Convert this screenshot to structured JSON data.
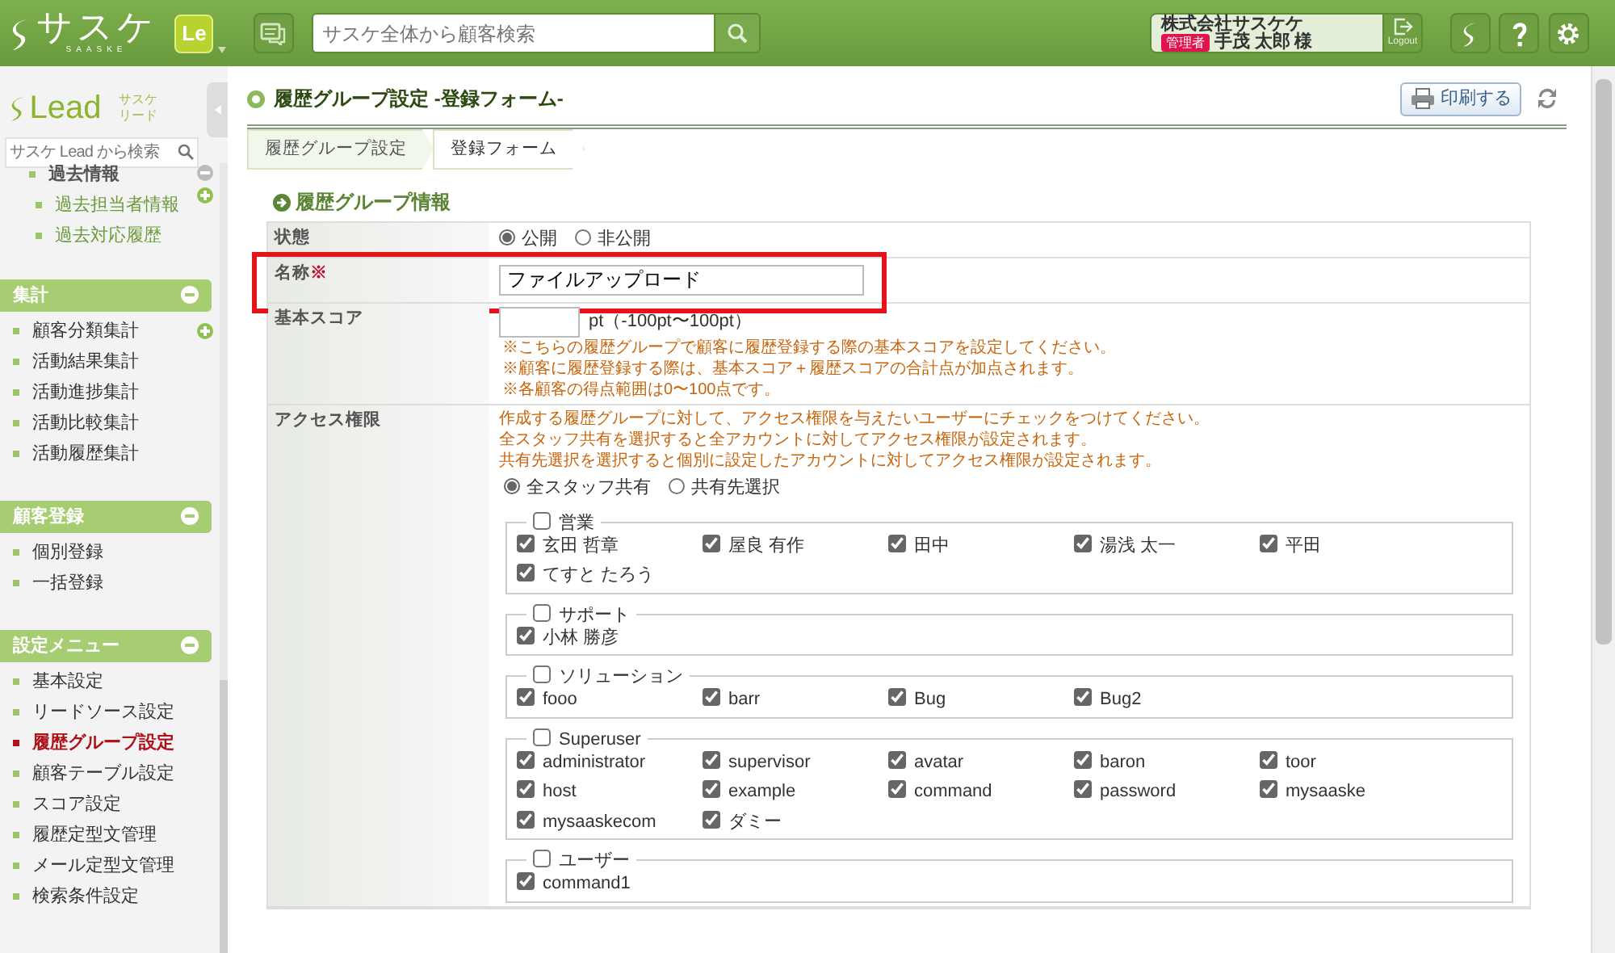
{
  "header": {
    "logo": "サスケ",
    "logo_sub": "SAASKE",
    "app_badge": "Le",
    "search": {
      "placeholder": "サスケ全体から顧客検索"
    },
    "user": {
      "company": "株式会社サスケケ",
      "role": "管理者",
      "name": "手茂 太郎",
      "honorific": "様",
      "logout": "Logout"
    }
  },
  "sidebar": {
    "brand": "Lead",
    "brand_sub_lines": [
      "サスケ",
      "リード"
    ],
    "search": {
      "placeholder": "サスケ Lead から検索"
    },
    "top_group": {
      "label": "過去情報",
      "children": [
        {
          "label": "過去担当者情報"
        },
        {
          "label": "過去対応履歴"
        }
      ]
    },
    "sections": [
      {
        "title": "集計",
        "items": [
          {
            "label": "顧客分類集計",
            "selected": false
          },
          {
            "label": "活動結果集計",
            "selected": false
          },
          {
            "label": "活動進捗集計",
            "selected": false
          },
          {
            "label": "活動比較集計",
            "selected": false
          },
          {
            "label": "活動履歴集計",
            "selected": false
          }
        ]
      },
      {
        "title": "顧客登録",
        "items": [
          {
            "label": "個別登録",
            "selected": false
          },
          {
            "label": "一括登録",
            "selected": false
          }
        ]
      },
      {
        "title": "設定メニュー",
        "items": [
          {
            "label": "基本設定",
            "selected": false
          },
          {
            "label": "リードソース設定",
            "selected": false
          },
          {
            "label": "履歴グループ設定",
            "selected": true
          },
          {
            "label": "顧客テーブル設定",
            "selected": false
          },
          {
            "label": "スコア設定",
            "selected": false
          },
          {
            "label": "履歴定型文管理",
            "selected": false
          },
          {
            "label": "メール定型文管理",
            "selected": false
          },
          {
            "label": "検索条件設定",
            "selected": false
          }
        ]
      }
    ]
  },
  "page": {
    "title": "履歴グループ設定 -登録フォーム-",
    "print_button": "印刷する",
    "breadcrumb": [
      {
        "label": "履歴グループ設定"
      },
      {
        "label": "登録フォーム"
      }
    ],
    "section_title": "履歴グループ情報"
  },
  "form": {
    "rows": [
      {
        "kind": "radio",
        "label": "状態",
        "options": [
          {
            "label": "公開",
            "selected": true
          },
          {
            "label": "非公開",
            "selected": false
          }
        ]
      },
      {
        "kind": "text",
        "label": "名称",
        "required_mark": "※",
        "highlighted": true,
        "value": "ファイルアップロード"
      },
      {
        "kind": "score",
        "label": "基本スコア",
        "value": "",
        "unit": "pt（-100pt〜100pt）",
        "notes": [
          "※こちらの履歴グループで顧客に履歴登録する際の基本スコアを設定してください。",
          "※顧客に履歴登録する際は、基本スコア＋履歴スコアの合計点が加点されます。",
          "※各顧客の得点範囲は0〜100点です。"
        ]
      },
      {
        "kind": "access",
        "label": "アクセス権限",
        "notes": [
          "作成する履歴グループに対して、アクセス権限を与えたいユーザーにチェックをつけてください。",
          "全スタッフ共有を選択すると全アカウントに対してアクセス権限が設定されます。",
          "共有先選択を選択すると個別に設定したアカウントに対してアクセス権限が設定されます。"
        ],
        "options": [
          {
            "label": "全スタッフ共有",
            "selected": true
          },
          {
            "label": "共有先選択",
            "selected": false
          }
        ],
        "groups": [
          {
            "label": "営業",
            "checked": false,
            "members": [
              {
                "label": "玄田 哲章",
                "checked": true
              },
              {
                "label": "屋良 有作",
                "checked": true
              },
              {
                "label": "田中",
                "checked": true
              },
              {
                "label": "湯浅 太一",
                "checked": true
              },
              {
                "label": "平田",
                "checked": true
              },
              {
                "label": "てすと たろう",
                "checked": true
              }
            ]
          },
          {
            "label": "サポート",
            "checked": false,
            "members": [
              {
                "label": "小林 勝彦",
                "checked": true
              }
            ]
          },
          {
            "label": "ソリューション",
            "checked": false,
            "members": [
              {
                "label": "fooo",
                "checked": true
              },
              {
                "label": "barr",
                "checked": true
              },
              {
                "label": "Bug",
                "checked": true
              },
              {
                "label": "Bug2",
                "checked": true
              }
            ]
          },
          {
            "label": "Superuser",
            "checked": false,
            "members": [
              {
                "label": "administrator",
                "checked": true
              },
              {
                "label": "supervisor",
                "checked": true
              },
              {
                "label": "avatar",
                "checked": true
              },
              {
                "label": "baron",
                "checked": true
              },
              {
                "label": "toor",
                "checked": true
              },
              {
                "label": "host",
                "checked": true
              },
              {
                "label": "example",
                "checked": true
              },
              {
                "label": "command",
                "checked": true
              },
              {
                "label": "password",
                "checked": true
              },
              {
                "label": "mysaaske",
                "checked": true
              },
              {
                "label": "mysaaskecom",
                "checked": true
              },
              {
                "label": "ダミー",
                "checked": true
              }
            ]
          },
          {
            "label": "ユーザー",
            "checked": false,
            "members": [
              {
                "label": "command1",
                "checked": true
              }
            ]
          }
        ]
      }
    ]
  }
}
